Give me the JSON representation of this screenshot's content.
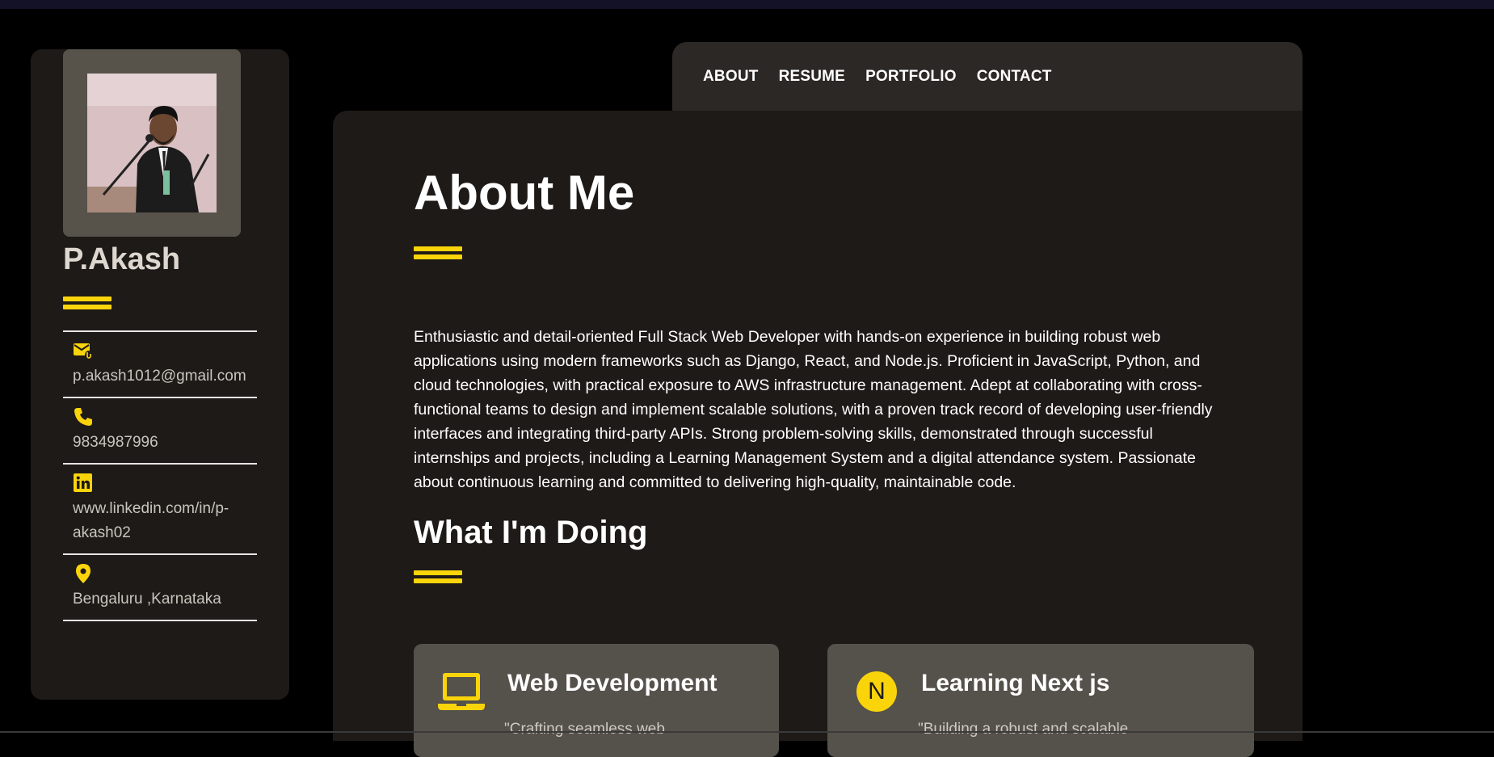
{
  "profile": {
    "name": "P.Akash",
    "photo_alt": "Profile photo",
    "contacts": [
      {
        "icon": "mail-icon",
        "value": "p.akash1012@gmail.com"
      },
      {
        "icon": "phone-icon",
        "value": "9834987996"
      },
      {
        "icon": "linkedin-icon",
        "value": "www.linkedin.com/in/p-akash02"
      },
      {
        "icon": "location-pin-icon",
        "value": "Bengaluru ,Karnataka"
      }
    ]
  },
  "nav": {
    "items": [
      "ABOUT",
      "RESUME",
      "PORTFOLIO",
      "CONTACT"
    ]
  },
  "about": {
    "title": "About Me",
    "paragraph": "Enthusiastic and detail-oriented Full Stack Web Developer with hands-on experience in building robust web applications using modern frameworks such as Django, React, and Node.js. Proficient in JavaScript, Python, and cloud technologies, with practical exposure to AWS infrastructure management. Adept at collaborating with cross-functional teams to design and implement scalable solutions, with a proven track record of developing user-friendly interfaces and integrating third-party APIs. Strong problem-solving skills, demonstrated through successful internships and projects, including a Learning Management System and a digital attendance system. Passionate about continuous learning and committed to delivering high-quality, maintainable code."
  },
  "doing": {
    "title": "What I'm Doing",
    "cards": [
      {
        "icon": "laptop-icon",
        "title": "Web Development",
        "desc": "\"Crafting seamless web"
      },
      {
        "icon": "nextjs-icon",
        "title": "Learning Next js",
        "desc": "\"Building a robust and scalable"
      }
    ]
  },
  "colors": {
    "accent": "#f9d40b",
    "page_bg": "#000000",
    "panel_bg": "#1e1a17",
    "navbar_bg": "#2c2826",
    "card_bg": "#55514b"
  }
}
